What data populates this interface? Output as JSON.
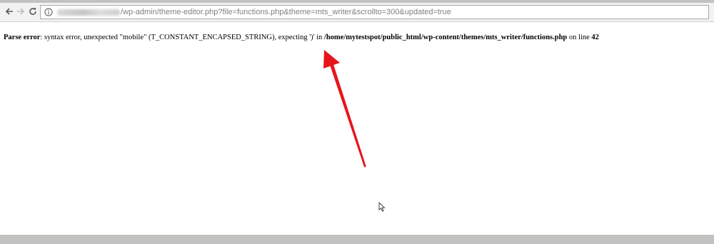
{
  "browser": {
    "back_icon": "arrow-left-icon",
    "forward_icon": "arrow-right-icon",
    "reload_icon": "reload-icon",
    "info_icon": "info-icon",
    "url_path": "/wp-admin/theme-editor.php?file=functions.php&theme=mts_writer&scrollto=300&updated=true"
  },
  "error": {
    "label": "Parse error",
    "message": ": syntax error, unexpected \"mobile\" (T_CONSTANT_ENCAPSED_STRING), expecting ')' in ",
    "file_path": "/home/mytestspot/public_html/wp-content/themes/mts_writer/functions.php",
    "line_prefix": " on line ",
    "line_number": "42"
  },
  "colors": {
    "arrow": "#e8141b",
    "chrome_gray": "#c4c2c1"
  }
}
